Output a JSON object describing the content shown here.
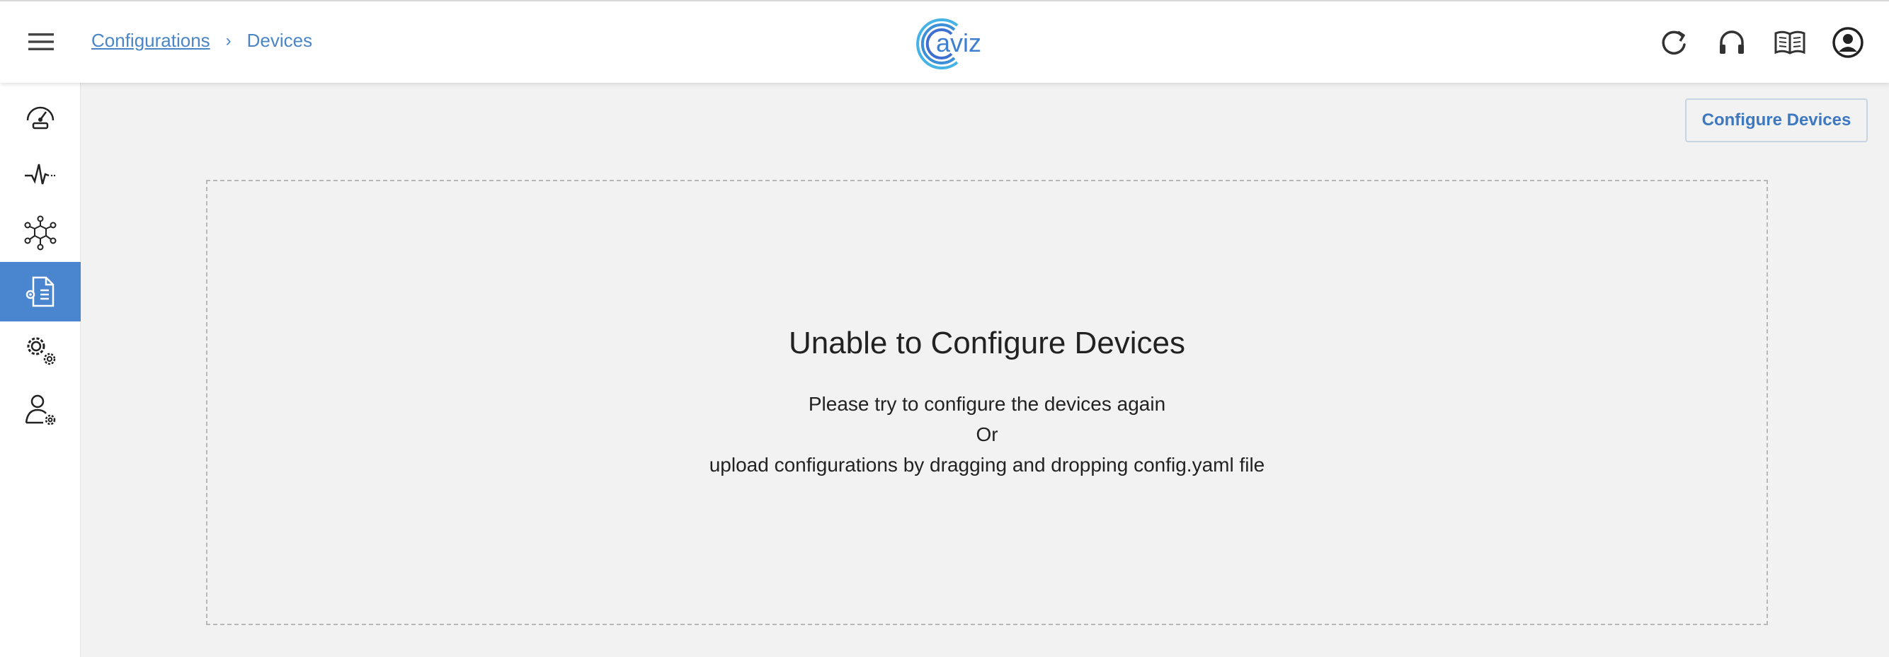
{
  "header": {
    "breadcrumb": {
      "parent": "Configurations",
      "separator": "›",
      "current": "Devices"
    },
    "logo_text": "aviz",
    "icons": [
      "refresh-icon",
      "headset-icon",
      "docs-book-icon",
      "account-icon"
    ],
    "accent_color": "#4a86c7"
  },
  "sidebar": {
    "items": [
      {
        "icon": "dashboard-gauge-icon",
        "active": false
      },
      {
        "icon": "pulse-monitor-icon",
        "active": false
      },
      {
        "icon": "network-cube-icon",
        "active": false
      },
      {
        "icon": "config-document-icon",
        "active": true
      },
      {
        "icon": "settings-gears-icon",
        "active": false
      },
      {
        "icon": "user-settings-icon",
        "active": false
      }
    ],
    "active_color": "#4a86d0"
  },
  "main": {
    "configure_button_label": "Configure Devices",
    "dropzone": {
      "title": "Unable to Configure Devices",
      "line1": "Please try to configure the devices again",
      "line2": "Or",
      "line3": "upload configurations by dragging and dropping config.yaml file"
    }
  }
}
